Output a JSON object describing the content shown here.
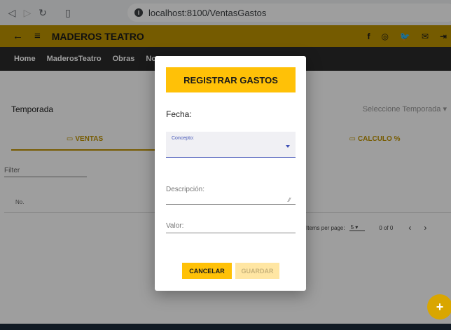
{
  "browser": {
    "url": "localhost:8100/VentasGastos",
    "back_icon": "back-triangle-icon",
    "forward_icon": "forward-triangle-icon",
    "reload_icon": "reload-icon",
    "bookmark_icon": "bookmark-icon"
  },
  "appbar": {
    "title": "MADEROS TEATRO",
    "back_glyph": "←",
    "menu_glyph": "≡",
    "color": "#bd9300",
    "social": [
      "f",
      "◎",
      "🐦",
      "✉",
      "⇥"
    ]
  },
  "menu": {
    "items": [
      "Home",
      "MaderosTeatro",
      "Obras",
      "No"
    ]
  },
  "page": {
    "temporada_label": "Temporada",
    "temporada_placeholder": "Seleccione Temporada ▾",
    "tab_ventas": "VENTAS",
    "tab_calculo": "CALCULO %",
    "filter_placeholder": "Filter",
    "col_no": "No.",
    "items_per_page_label": "Items per page:",
    "items_per_page_value": "5",
    "range_label": "0 of 0",
    "fab_glyph": "+"
  },
  "dialog": {
    "title": "REGISTRAR GASTOS",
    "fecha_label": "Fecha:",
    "concepto_label": "Concepto:",
    "descripcion_label": "Descripción:",
    "valor_label": "Valor:",
    "cancel_label": "CANCELAR",
    "save_label": "GUARDAR",
    "accent": "#ffc107"
  }
}
